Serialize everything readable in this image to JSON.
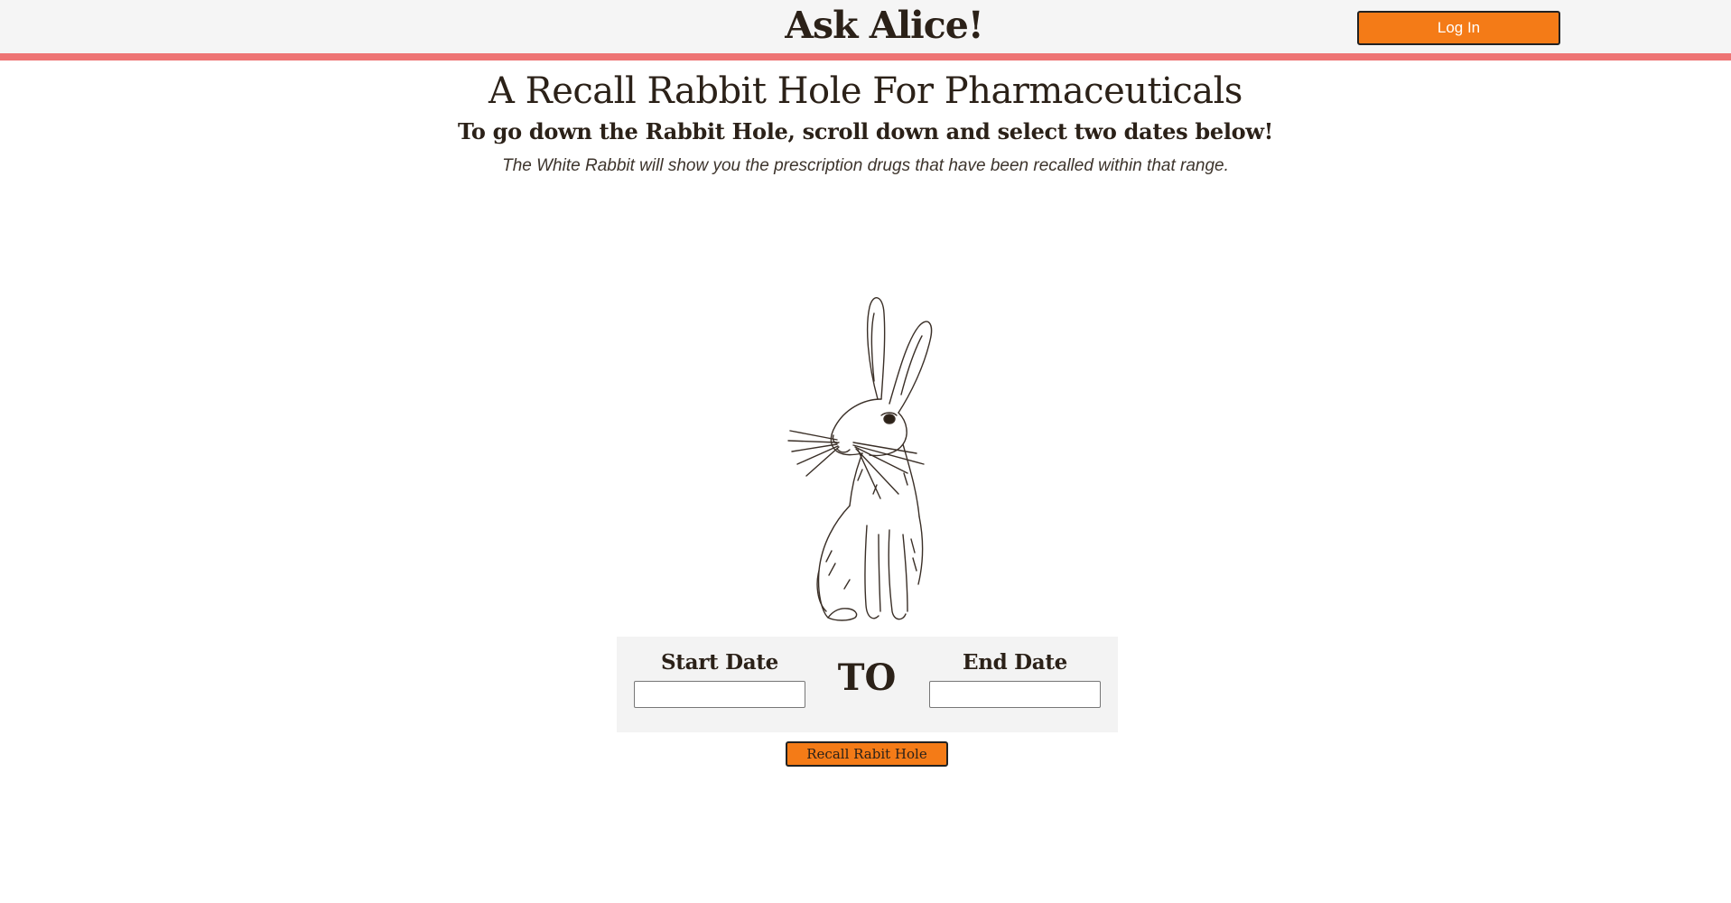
{
  "header": {
    "title": "Ask Alice!",
    "login_label": "Log In"
  },
  "main": {
    "title": "A Recall Rabbit Hole For Pharmaceuticals",
    "subtitle": "To go down the Rabbit Hole, scroll down and select two dates below!",
    "description": "The White Rabbit will show you the prescription drugs that have been recalled within that range."
  },
  "date_form": {
    "start_label": "Start Date",
    "start_value": "",
    "separator": "TO",
    "end_label": "End Date",
    "end_value": "",
    "submit_label": "Recall Rabit Hole"
  },
  "colors": {
    "header_bg": "#f5f5f5",
    "header_border": "#ee7474",
    "accent": "#f47b17",
    "text": "#2b2118",
    "panel_bg": "#f3f3f3"
  },
  "images": {
    "rabbit": "rabbit-sketch-illustration"
  }
}
